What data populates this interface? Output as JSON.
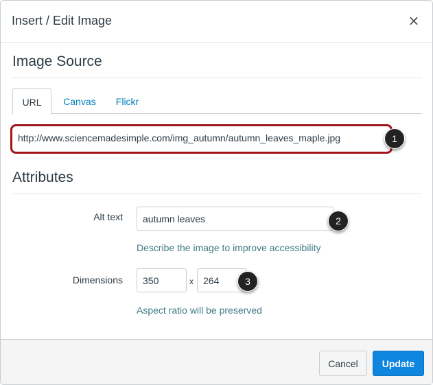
{
  "dialog": {
    "title": "Insert / Edit Image",
    "close_icon": "×"
  },
  "image_source": {
    "heading": "Image Source",
    "tabs": [
      {
        "label": "URL",
        "active": true
      },
      {
        "label": "Canvas",
        "active": false
      },
      {
        "label": "Flickr",
        "active": false
      }
    ],
    "url_value": "http://www.sciencemadesimple.com/img_autumn/autumn_leaves_maple.jpg"
  },
  "attributes": {
    "heading": "Attributes",
    "alt_text_label": "Alt text",
    "alt_text_value": "autumn leaves",
    "alt_text_hint": "Describe the image to improve accessibility",
    "dimensions_label": "Dimensions",
    "width_value": "350",
    "height_value": "264",
    "times_symbol": "x",
    "dimensions_hint": "Aspect ratio will be preserved"
  },
  "callouts": [
    "1",
    "2",
    "3"
  ],
  "footer": {
    "cancel_label": "Cancel",
    "update_label": "Update"
  },
  "colors": {
    "url_highlight": "#a0141a",
    "link_blue": "#0081bd",
    "primary_button": "#0f87e0"
  }
}
